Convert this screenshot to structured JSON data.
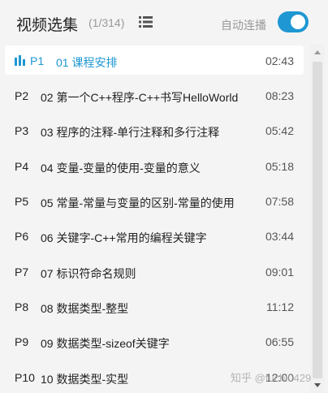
{
  "header": {
    "title": "视频选集",
    "count": "(1/314)",
    "autoplay_label": "自动连播",
    "autoplay_on": true
  },
  "playlist": [
    {
      "ep": "P1",
      "name": "01 课程安排",
      "duration": "02:43",
      "active": true
    },
    {
      "ep": "P2",
      "name": "02 第一个C++程序-C++书写HelloWorld",
      "duration": "08:23"
    },
    {
      "ep": "P3",
      "name": "03 程序的注释-单行注释和多行注释",
      "duration": "05:42"
    },
    {
      "ep": "P4",
      "name": "04 变量-变量的使用-变量的意义",
      "duration": "05:18"
    },
    {
      "ep": "P5",
      "name": "05 常量-常量与变量的区别-常量的使用",
      "duration": "07:58"
    },
    {
      "ep": "P6",
      "name": "06 关键字-C++常用的编程关键字",
      "duration": "03:44"
    },
    {
      "ep": "P7",
      "name": "07 标识符命名规则",
      "duration": "09:01"
    },
    {
      "ep": "P8",
      "name": "08 数据类型-整型",
      "duration": "11:12"
    },
    {
      "ep": "P9",
      "name": "09 数据类型-sizeof关键字",
      "duration": "06:55"
    },
    {
      "ep": "P10",
      "name": "10 数据类型-实型",
      "duration": "12:00"
    }
  ],
  "watermark": "知乎 @fuchi0429",
  "colors": {
    "accent": "#1e97d3",
    "background": "#f4f4f4"
  },
  "icons": {
    "list_view": "list-icon",
    "playing": "equalizer-icon"
  }
}
